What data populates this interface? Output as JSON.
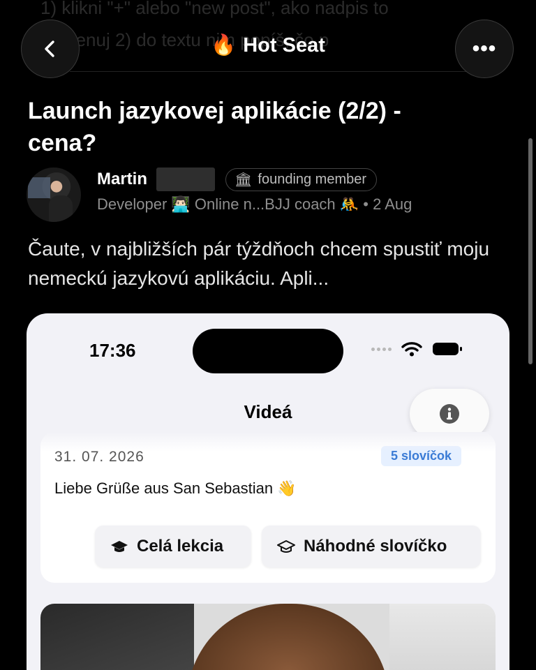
{
  "background_text": {
    "line1": "1) klikni \"+\" alebo \"new post\", ako nadpis to",
    "line2": "pomenuj 2) do textu nim popíš, čo p"
  },
  "nav": {
    "title": "Hot Seat",
    "title_emoji": "🔥",
    "back_icon": "chevron-left-icon",
    "more_label": "•••"
  },
  "post": {
    "title": "Launch jazykovej aplikácie (2/2) - cena?",
    "author_name": "Martin",
    "badge_emoji": "🏛",
    "badge_label": "founding member",
    "author_meta": "Developer 👨🏻‍💻 Online n...BJJ coach 🤼 • 2 Aug",
    "excerpt": "Čaute, v najbližších pár týždňoch chcem spustiť moju nemeckú jazykovú aplikáciu. Apli..."
  },
  "phone": {
    "status_time": "17:36",
    "screen_title": "Videá",
    "card": {
      "date": "31. 07. 2026",
      "word_count": "5 slovíčok",
      "message": "Liebe Grüße aus San Sebastian",
      "message_emoji": "👋",
      "lesson_button": "Celá lekcia",
      "random_button": "Náhodné slovíčko"
    }
  },
  "colors": {
    "background": "#000000",
    "phone_background": "#f2f2f7",
    "badge_border": "#444444",
    "accent_blue": "#3a7bd5"
  }
}
